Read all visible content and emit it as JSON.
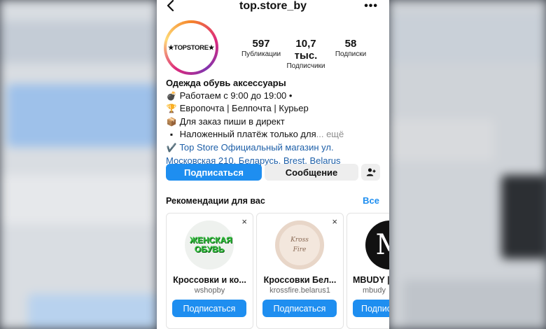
{
  "header": {
    "username": "top.store_by",
    "back_icon": "chevron-left-icon",
    "more_label": "•••"
  },
  "profile": {
    "avatar_text": "★TOPSTORE★",
    "stats": [
      {
        "value": "597",
        "label": "Публикации"
      },
      {
        "value": "10,7 тыс.",
        "label": "Подписчики"
      },
      {
        "value": "58",
        "label": "Подписки"
      }
    ],
    "bio": {
      "name": "Одежда обувь аксессуары",
      "lines": [
        {
          "emoji": "💣",
          "text": "Работаем с 9:00 до 19:00 •"
        },
        {
          "emoji": "🏆",
          "text": "Европочта | Белпочта | Курьер"
        },
        {
          "emoji": "📦",
          "text": "Для заказ пиши в директ"
        },
        {
          "emoji": "▪",
          "text": "Наложенный платёж только для",
          "more": "... ещё"
        }
      ],
      "location_check": "✔️",
      "location_link": "Top Store Официальный магазин",
      "location_text1": "ул.",
      "location_text2": "Московская 210, Беларусь, Brest, Belarus"
    }
  },
  "actions": {
    "follow_label": "Подписаться",
    "message_label": "Сообщение",
    "add_person_icon": "add-person-icon"
  },
  "recommendations": {
    "title": "Рекомендации для вас",
    "see_all": "Все",
    "close_glyph": "×",
    "cards": [
      {
        "pic_text": "ЖЕНСКАЯ ОБУВЬ",
        "title": "Кроссовки и ко...",
        "handle": "wshopby",
        "button": "Подписаться"
      },
      {
        "pic_text": "Kross Fire",
        "title": "Кроссовки Бел...",
        "handle": "krossfire.belarus1",
        "button": "Подписаться"
      },
      {
        "pic_text": "M",
        "title": "MBUDY | ",
        "handle": "mbudy",
        "button": "Подписаться"
      }
    ]
  },
  "colors": {
    "accent": "#1e8ef0",
    "link": "#1d5fa8"
  }
}
